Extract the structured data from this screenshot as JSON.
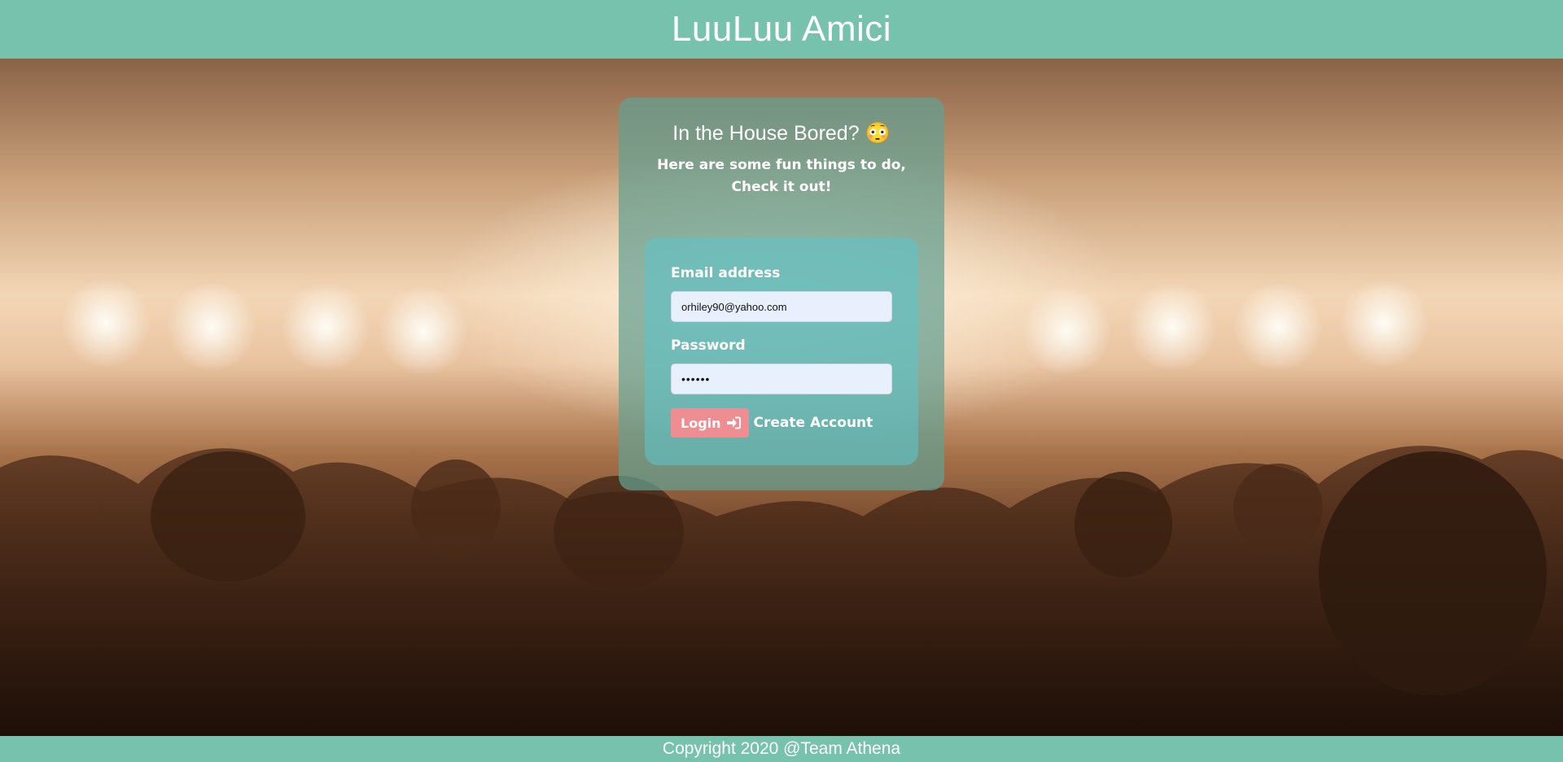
{
  "header": {
    "title": "LuuLuu Amici"
  },
  "card": {
    "title": "In the House Bored?",
    "title_emoji": "😳",
    "subtitle": "Here are some fun things to do, Check it out!"
  },
  "form": {
    "email_label": "Email address",
    "email_value": "orhiley90@yahoo.com",
    "password_label": "Password",
    "password_value": "••••••",
    "login_label": "Login",
    "login_icon": "sign-in-icon",
    "create_account_label": "Create Account"
  },
  "footer": {
    "copyright": "Copyright 2020 @Team Athena"
  },
  "colors": {
    "header_bg": "#77c2ac",
    "login_button": "#ee8e92",
    "input_bg": "#e8f0fe"
  }
}
